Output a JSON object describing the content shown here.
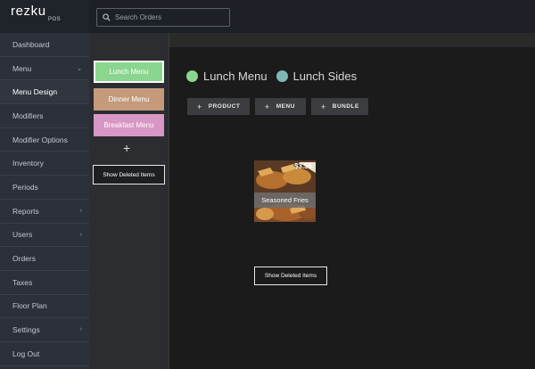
{
  "brand": {
    "name": "rezku",
    "sub": "POS"
  },
  "search": {
    "placeholder": "Search Orders"
  },
  "nav": {
    "items": [
      {
        "label": "Dashboard",
        "has_chevron": false
      },
      {
        "label": "Menu",
        "has_chevron": true,
        "chevron": "⌄"
      },
      {
        "label": "Menu Design",
        "has_chevron": false
      },
      {
        "label": "Modifiers",
        "has_chevron": false
      },
      {
        "label": "Modifier Options",
        "has_chevron": false
      },
      {
        "label": "Inventory",
        "has_chevron": false
      },
      {
        "label": "Periods",
        "has_chevron": false
      },
      {
        "label": "Reports",
        "has_chevron": true,
        "chevron": "›"
      },
      {
        "label": "Users",
        "has_chevron": true,
        "chevron": "›"
      },
      {
        "label": "Orders",
        "has_chevron": false
      },
      {
        "label": "Taxes",
        "has_chevron": false
      },
      {
        "label": "Floor Plan",
        "has_chevron": false
      },
      {
        "label": "Settings",
        "has_chevron": true,
        "chevron": "›"
      },
      {
        "label": "Log Out",
        "has_chevron": false
      }
    ]
  },
  "menus": {
    "items": [
      {
        "label": "Lunch Menu",
        "color": "#8bd68e"
      },
      {
        "label": "Dinner Menu",
        "color": "#c49a7a"
      },
      {
        "label": "Breakfast Menu",
        "color": "#d897c4"
      }
    ],
    "add_label": "+",
    "show_deleted_label": "Show Deleted Items"
  },
  "main": {
    "legend": [
      {
        "label": "Lunch Menu",
        "color": "#8bd68e"
      },
      {
        "label": "Lunch Sides",
        "color": "#7fb7b4"
      }
    ],
    "actions": [
      {
        "label": "PRODUCT"
      },
      {
        "label": "MENU"
      },
      {
        "label": "BUNDLE"
      }
    ],
    "plus_glyph": "+",
    "product": {
      "name": "Seasoned Fries",
      "price": "$3.55"
    },
    "show_deleted_label": "Show Deleted Items"
  }
}
